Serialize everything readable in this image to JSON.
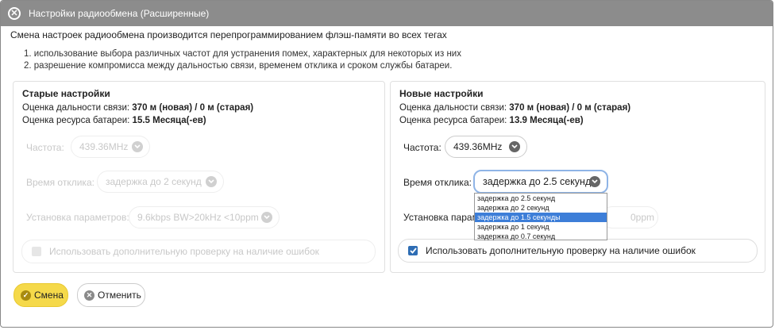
{
  "window": {
    "title": "Настройки радиообмена (Расширенные)"
  },
  "intro": "Смена настроек радиообмена производится перепрограммированием флэш-памяти во всех тегах",
  "reasons": [
    "1. использование выбора различных частот для устранения помех, характерных для некоторых из них",
    "2. разрешение компромисса между дальностью связи, временем отклика и сроком службы батареи."
  ],
  "old": {
    "title": "Старые настройки",
    "range_label": "Оценка дальности связи:",
    "range_value": "370 м (новая) / 0 м (старая)",
    "battery_label": "Оценка ресурса батареи:",
    "battery_value": "15.5 Месяца(-ев)",
    "freq_label": "Частота:",
    "freq_value": "439.36MHz",
    "resp_label": "Время отклика:",
    "resp_value": "задержка до 2 секунд",
    "params_label": "Установка параметров:",
    "params_value": "9.6kbps BW>20kHz <10ppm",
    "check_label": "Использовать дополнительную проверку на наличие ошибок",
    "checked": false
  },
  "new": {
    "title": "Новые настройки",
    "range_label": "Оценка дальности связи:",
    "range_value": "370 м (новая) / 0 м (старая)",
    "battery_label": "Оценка ресурса батареи:",
    "battery_value": "13.9 Месяца(-ев)",
    "freq_label": "Частота:",
    "freq_value": "439.36MHz",
    "resp_label": "Время отклика:",
    "resp_value": "задержка до 2.5 секунд",
    "params_label": "Установка парам",
    "params_tail": "0ppm",
    "check_label": "Использовать дополнительную проверку на наличие ошибок",
    "checked": true
  },
  "dropdown": {
    "options": [
      "задержка до 2.5 секунд",
      "задержка до 2 секунд",
      "задержка до 1.5 секунды",
      "задержка до 1 секунд",
      "задержка до 0.7 секунд"
    ],
    "highlighted_index": 2
  },
  "buttons": {
    "apply": "Смена",
    "cancel": "Отменить"
  },
  "colors": {
    "titlebar": "#8c8c8c",
    "apply_bg": "#f5d94a",
    "highlight": "#3d7ed8",
    "check": "#2e6db4"
  }
}
